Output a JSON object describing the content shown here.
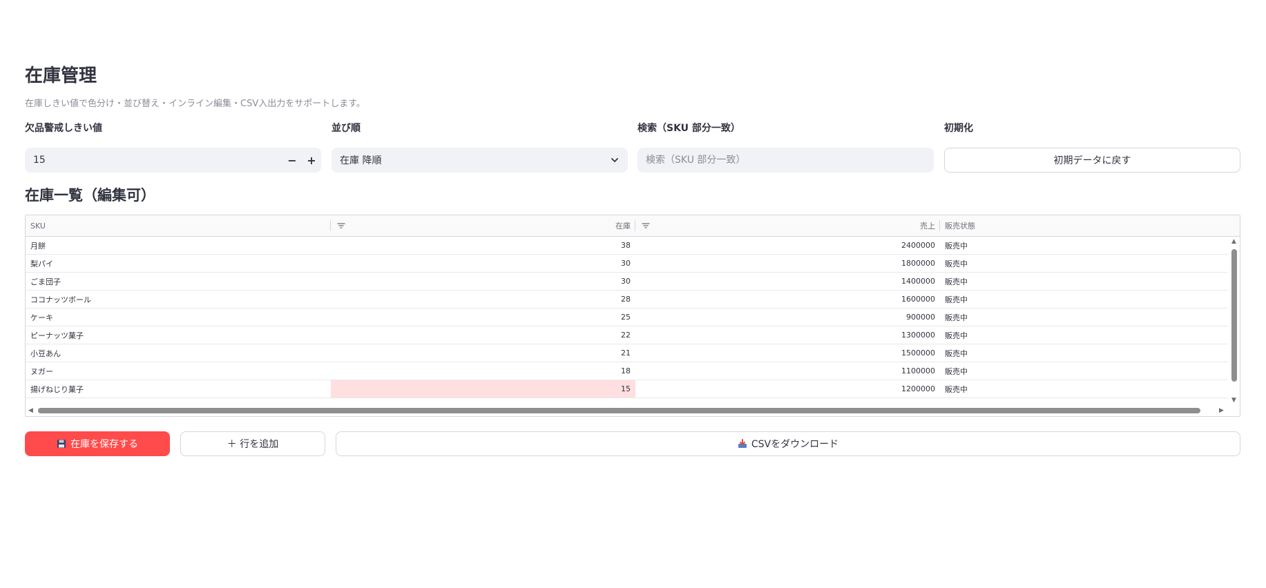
{
  "header": {
    "title": "在庫管理",
    "caption": "在庫しきい値で色分け・並び替え・インライン編集・CSV入出力をサポートします。"
  },
  "controls": {
    "threshold": {
      "label": "欠品警戒しきい値",
      "value": "15",
      "minus": "−",
      "plus": "+"
    },
    "sort": {
      "label": "並び順",
      "value": "在庫 降順"
    },
    "search": {
      "label": "検索（SKU 部分一致）",
      "placeholder": "検索（SKU 部分一致）"
    },
    "reset": {
      "label": "初期化",
      "button": "初期データに戻す"
    }
  },
  "table": {
    "title": "在庫一覧（編集可）",
    "columns": [
      "SKU",
      "在庫",
      "売上",
      "販売状態"
    ],
    "rows": [
      {
        "sku": "月餅",
        "stock": "38",
        "sales": "2400000",
        "status": "販売中"
      },
      {
        "sku": "梨パイ",
        "stock": "30",
        "sales": "1800000",
        "status": "販売中"
      },
      {
        "sku": "ごま団子",
        "stock": "30",
        "sales": "1400000",
        "status": "販売中"
      },
      {
        "sku": "ココナッツボール",
        "stock": "28",
        "sales": "1600000",
        "status": "販売中"
      },
      {
        "sku": "ケーキ",
        "stock": "25",
        "sales": "900000",
        "status": "販売中"
      },
      {
        "sku": "ピーナッツ菓子",
        "stock": "22",
        "sales": "1300000",
        "status": "販売中"
      },
      {
        "sku": "小豆あん",
        "stock": "21",
        "sales": "1500000",
        "status": "販売中"
      },
      {
        "sku": "ヌガー",
        "stock": "18",
        "sales": "1100000",
        "status": "販売中"
      },
      {
        "sku": "揚げねじり菓子",
        "stock": "15",
        "sales": "1200000",
        "status": "販売中"
      }
    ],
    "low_stock_color": "#ffdfe0"
  },
  "actions": {
    "save": "在庫を保存する",
    "add_row": "＋ 行を追加",
    "download_csv": "CSVをダウンロード"
  },
  "colors": {
    "primary": "#ff4b4b",
    "text": "#31333f",
    "input_bg": "#f0f2f6"
  }
}
